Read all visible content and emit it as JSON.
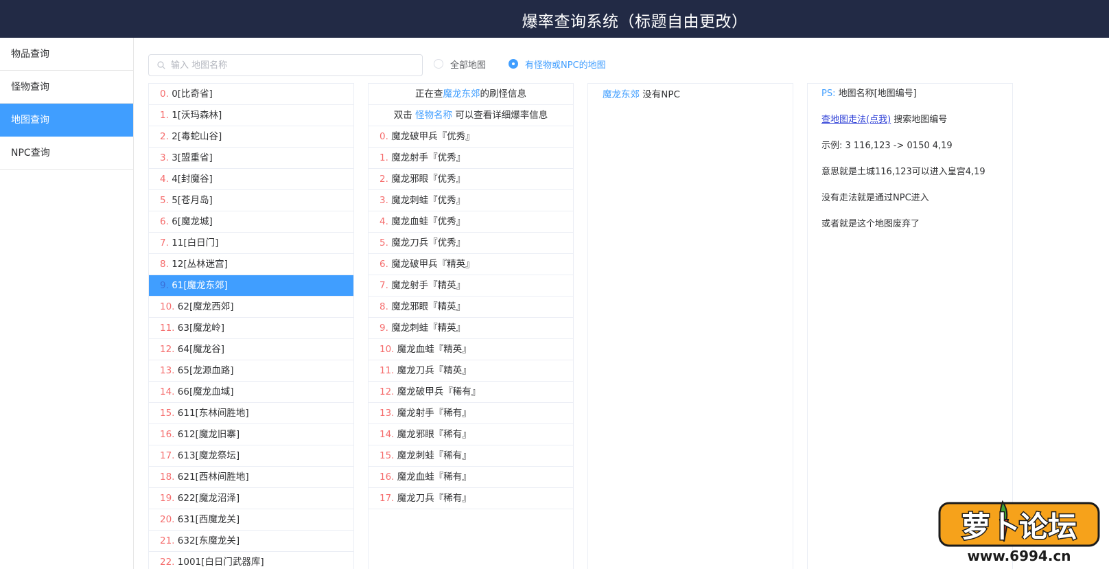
{
  "header": {
    "title": "爆率查询系统（标题自由更改）"
  },
  "sidebar": {
    "items": [
      {
        "label": "物品查询",
        "active": false
      },
      {
        "label": "怪物查询",
        "active": false
      },
      {
        "label": "地图查询",
        "active": true
      },
      {
        "label": "NPC查询",
        "active": false
      }
    ]
  },
  "search": {
    "placeholder": "输入 地图名称",
    "value": ""
  },
  "filters": {
    "all_maps": "全部地图",
    "with_monsters": "有怪物或NPC的地图",
    "selected": "with_monsters"
  },
  "maps": {
    "selected_index": 9,
    "items": [
      {
        "idx": "0.",
        "text": "0[比奇省]"
      },
      {
        "idx": "1.",
        "text": "1[沃玛森林]"
      },
      {
        "idx": "2.",
        "text": "2[毒蛇山谷]"
      },
      {
        "idx": "3.",
        "text": "3[盟重省]"
      },
      {
        "idx": "4.",
        "text": "4[封魔谷]"
      },
      {
        "idx": "5.",
        "text": "5[苍月岛]"
      },
      {
        "idx": "6.",
        "text": "6[魔龙城]"
      },
      {
        "idx": "7.",
        "text": "11[白日门]"
      },
      {
        "idx": "8.",
        "text": "12[丛林迷宫]"
      },
      {
        "idx": "9.",
        "text": "61[魔龙东郊]"
      },
      {
        "idx": "10.",
        "text": "62[魔龙西郊]"
      },
      {
        "idx": "11.",
        "text": "63[魔龙岭]"
      },
      {
        "idx": "12.",
        "text": "64[魔龙谷]"
      },
      {
        "idx": "13.",
        "text": "65[龙源血路]"
      },
      {
        "idx": "14.",
        "text": "66[魔龙血域]"
      },
      {
        "idx": "15.",
        "text": "611[东林间胜地]"
      },
      {
        "idx": "16.",
        "text": "612[魔龙旧寨]"
      },
      {
        "idx": "17.",
        "text": "613[魔龙祭坛]"
      },
      {
        "idx": "18.",
        "text": "621[西林间胜地]"
      },
      {
        "idx": "19.",
        "text": "622[魔龙沼泽]"
      },
      {
        "idx": "20.",
        "text": "631[西魔龙关]"
      },
      {
        "idx": "21.",
        "text": "632[东魔龙关]"
      },
      {
        "idx": "22.",
        "text": "1001[白日门武器库]"
      }
    ]
  },
  "monsters": {
    "header_prefix": "正在查",
    "header_map": "魔龙东郊",
    "header_suffix": "的刷怪信息",
    "hint_prefix": "双击 ",
    "hint_link": "怪物名称",
    "hint_suffix": " 可以查看详细爆率信息",
    "items": [
      {
        "idx": "0.",
        "text": "魔龙破甲兵『优秀』"
      },
      {
        "idx": "1.",
        "text": "魔龙射手『优秀』"
      },
      {
        "idx": "2.",
        "text": "魔龙邪眼『优秀』"
      },
      {
        "idx": "3.",
        "text": "魔龙刺蛙『优秀』"
      },
      {
        "idx": "4.",
        "text": "魔龙血蛙『优秀』"
      },
      {
        "idx": "5.",
        "text": "魔龙刀兵『优秀』"
      },
      {
        "idx": "6.",
        "text": "魔龙破甲兵『精英』"
      },
      {
        "idx": "7.",
        "text": "魔龙射手『精英』"
      },
      {
        "idx": "8.",
        "text": "魔龙邪眼『精英』"
      },
      {
        "idx": "9.",
        "text": "魔龙刺蛙『精英』"
      },
      {
        "idx": "10.",
        "text": "魔龙血蛙『精英』"
      },
      {
        "idx": "11.",
        "text": "魔龙刀兵『精英』"
      },
      {
        "idx": "12.",
        "text": "魔龙破甲兵『稀有』"
      },
      {
        "idx": "13.",
        "text": "魔龙射手『稀有』"
      },
      {
        "idx": "14.",
        "text": "魔龙邪眼『稀有』"
      },
      {
        "idx": "15.",
        "text": "魔龙刺蛙『稀有』"
      },
      {
        "idx": "16.",
        "text": "魔龙血蛙『稀有』"
      },
      {
        "idx": "17.",
        "text": "魔龙刀兵『稀有』"
      }
    ]
  },
  "npc": {
    "map_name": "魔龙东郊",
    "text": " 没有NPC"
  },
  "info": {
    "ps_label": "PS: ",
    "ps_text": "地图名称[地图编号]",
    "link": "查地图走法(点我)",
    "link_suffix": " 搜索地图编号",
    "example": "示例: 3 116,123 -> 0150 4,19",
    "meaning": "意思就是土城116,123可以进入皇宫4,19",
    "no_path": "没有走法就是通过NPC进入",
    "abandoned": "或者就是这个地图废弃了"
  },
  "watermark": {
    "text": "萝卜论坛",
    "url": "www.6994.cn"
  },
  "colors": {
    "header_bg": "#222a45",
    "accent": "#409eff",
    "index_red": "#f56c6c",
    "link_blue": "#2a3cd6"
  }
}
